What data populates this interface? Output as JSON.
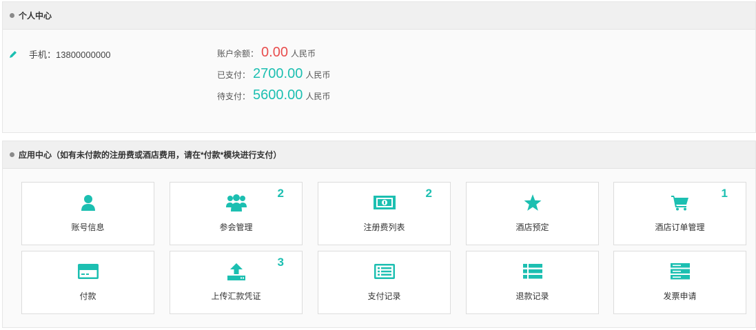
{
  "personal": {
    "title": "个人中心",
    "phone": "手机：13800000000",
    "balance": {
      "label": "账户余额：",
      "value": "0.00",
      "unit": "人民币"
    },
    "paid": {
      "label": "已支付：",
      "value": "2700.00",
      "unit": "人民币"
    },
    "pending": {
      "label": "待支付：",
      "value": "5600.00",
      "unit": "人民币"
    }
  },
  "apps": {
    "title": "应用中心（如有未付款的注册费或酒店费用，请在*付款*模块进行支付）",
    "tiles": [
      {
        "label": "账号信息",
        "icon": "user-icon",
        "badge": ""
      },
      {
        "label": "参会管理",
        "icon": "users-icon",
        "badge": "2"
      },
      {
        "label": "注册费列表",
        "icon": "money-bill-icon",
        "badge": "2"
      },
      {
        "label": "酒店预定",
        "icon": "star-icon",
        "badge": ""
      },
      {
        "label": "酒店订单管理",
        "icon": "cart-icon",
        "badge": "1"
      },
      {
        "label": "付款",
        "icon": "credit-card-icon",
        "badge": ""
      },
      {
        "label": "上传汇款凭证",
        "icon": "upload-icon",
        "badge": "3"
      },
      {
        "label": "支付记录",
        "icon": "list-alt-icon",
        "badge": ""
      },
      {
        "label": "退款记录",
        "icon": "list-icon",
        "badge": ""
      },
      {
        "label": "发票申请",
        "icon": "server-icon",
        "badge": ""
      }
    ]
  },
  "colors": {
    "accent": "#1cbfb1",
    "balance_zero": "#e84d4d"
  }
}
